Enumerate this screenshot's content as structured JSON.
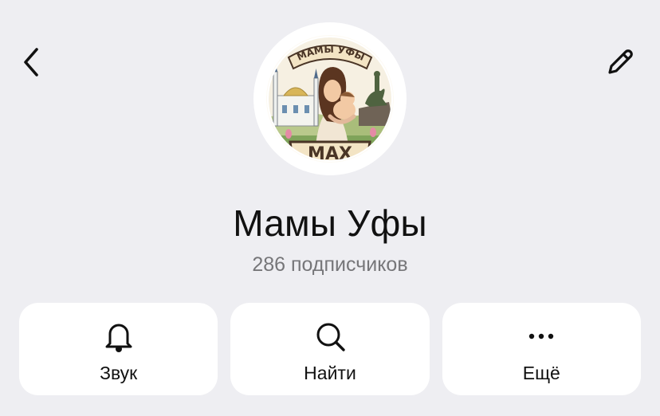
{
  "header": {
    "back_icon": "chevron-left-icon",
    "edit_icon": "pencil-icon"
  },
  "avatar": {
    "banner_text": "МАМЫ УФЫ",
    "badge_text": "MAX"
  },
  "channel": {
    "title": "Мамы Уфы",
    "subscribers": "286 подписчиков"
  },
  "actions": [
    {
      "label": "Звук",
      "icon": "bell-icon"
    },
    {
      "label": "Найти",
      "icon": "search-icon"
    },
    {
      "label": "Ещё",
      "icon": "more-dots-icon"
    }
  ],
  "colors": {
    "background": "#eeeef2",
    "card": "#ffffff",
    "text": "#111111",
    "muted": "#767679"
  }
}
